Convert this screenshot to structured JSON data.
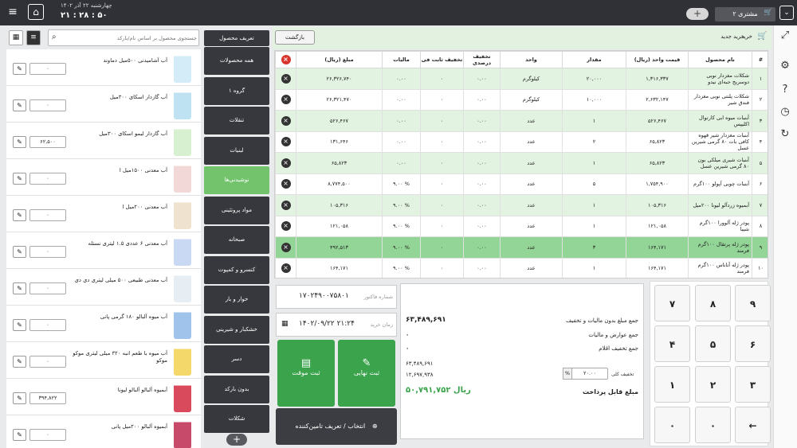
{
  "topbar": {
    "date": "چهارشنبه ۲۲ آذر ۱۴۰۲",
    "time": "۲۱ : ۲۸ : ۵۰",
    "customer": "مشتری ۲",
    "plus": "+"
  },
  "header": {
    "back": "بازگشت",
    "new_buy": "خرید جدید",
    "buy": "خرید"
  },
  "table": {
    "columns": [
      "#",
      "نام محصول",
      "قیمت واحد (ریال)",
      "مقدار",
      "واحد",
      "تخفیف درصدی",
      "تخفیف ثابت فی",
      "مالیات",
      "مبلغ (ریال)"
    ],
    "rows": [
      {
        "n": "۱",
        "name": "شکلات مغزدار نوبی دوسریج حبه‌ای نیدو",
        "price": "۱,۳۱۶,۳۳۷",
        "qty": "۲۰,۰۰۰",
        "unit": "کیلوگرم",
        "pct": "۰.۰۰",
        "fixed": "۰",
        "tax": "۰.۰۰",
        "amount": "۲۶,۳۲۶,۷۴۰"
      },
      {
        "n": "۲",
        "name": "شکلات پلنتی نوبی مغزدار فندق شیر",
        "price": "۲,۶۳۲,۱۴۷",
        "qty": "۱۰,۰۰۰",
        "unit": "کیلوگرم",
        "pct": "۰.۰۰",
        "fixed": "۰",
        "tax": "۰.۰۰",
        "amount": "۲۶,۳۲۱,۴۷۰"
      },
      {
        "n": "۳",
        "name": "آبنبات میوه ابی کارتوال اکلیپس",
        "price": "۵۲۶,۴۶۷",
        "qty": "۱",
        "unit": "عدد",
        "pct": "۰.۰۰",
        "fixed": "۰",
        "tax": "۰.۰۰",
        "amount": "۵۲۶,۴۶۷"
      },
      {
        "n": "۴",
        "name": "آبنبات مغزدار شیر قهوه کافی بات ۸۰ گرمی شیرین عسل",
        "price": "۶۵,۸۲۳",
        "qty": "۲",
        "unit": "عدد",
        "pct": "۰.۰۰",
        "fixed": "۰",
        "tax": "۰.۰۰",
        "amount": "۱۳۱,۶۴۶"
      },
      {
        "n": "۵",
        "name": "آبنبات شیری میلکی بون ۸۰ گرمی شیرین عسل",
        "price": "۶۵,۸۲۳",
        "qty": "۱",
        "unit": "عدد",
        "pct": "۰.۰۰",
        "fixed": "۰",
        "tax": "۰.۰۰",
        "amount": "۶۵,۸۲۳"
      },
      {
        "n": "۶",
        "name": "آبنبات چوبی آپولو ۱۰۰گرم",
        "price": "۱,۷۵۴,۹۰۰",
        "qty": "۵",
        "unit": "عدد",
        "pct": "۰.۰۰",
        "fixed": "۰",
        "tax": "% ۹.۰۰",
        "amount": "۸,۷۷۴,۵۰۰"
      },
      {
        "n": "۷",
        "name": "آبمیوه زردآلو لیونا ۲۰۰میل",
        "price": "۱۰۵,۳۱۶",
        "qty": "۱",
        "unit": "عدد",
        "pct": "۰.۰۰",
        "fixed": "۰",
        "tax": "% ۹.۰۰",
        "amount": "۱۰۵,۳۱۶"
      },
      {
        "n": "۸",
        "name": "پودر ژله آلوورا ۱۰۰گرم شیبا",
        "price": "۱۲۱,۰۵۸",
        "qty": "۱",
        "unit": "عدد",
        "pct": "۰.۰۰",
        "fixed": "۰",
        "tax": "% ۹.۰۰",
        "amount": "۱۲۱,۰۵۸"
      },
      {
        "n": "۹",
        "name": "پودر ژله پرتقال ۱۰۰گرم فرمند",
        "price": "۱۶۴,۱۷۱",
        "qty": "۳",
        "unit": "عدد",
        "pct": "۰.۰۰",
        "fixed": "۰",
        "tax": "% ۹.۰۰",
        "amount": "۴۹۲,۵۱۳"
      },
      {
        "n": "۱۰",
        "name": "پودر ژله آناناس ۱۰۰گرم فرمند",
        "price": "۱۶۴,۱۷۱",
        "qty": "۱",
        "unit": "عدد",
        "pct": "۰.۰۰",
        "fixed": "۰",
        "tax": "% ۹.۰۰",
        "amount": "۱۶۴,۱۷۱"
      }
    ]
  },
  "numpad": [
    "۹",
    "۸",
    "۷",
    "۶",
    "۵",
    "۴",
    "۳",
    "۲",
    "۱",
    "←",
    "۰",
    "۰"
  ],
  "summary": {
    "total_label": "جمع مبلغ بدون مالیات و تخفیف",
    "total": "۶۳,۴۸۹,۶۹۱",
    "tax_label": "جمع عوارض و مالیات",
    "tax": "۰",
    "disc_label": "جمع تخفیف اقلام",
    "disc": "۰",
    "sub1": "۶۳,۴۸۹,۶۹۱",
    "sub2": "۱۲,۶۹۷,۹۳۸",
    "overall_disc_label": "تخفیف کلی",
    "overall_disc": "۲۰.۰۰",
    "pct_sign": "%",
    "pay_label": "مبلغ قابل پرداخت",
    "pay": "۵۰,۷۹۱,۷۵۲ ریال"
  },
  "invoice": {
    "no_label": "شماره فاکتور",
    "no": "۱۷۰۲۴۹۰۰۷۵۸۰۱",
    "time_label": "زمان خرید",
    "time": "۱۴۰۲/۰۹/۲۲ ۲۱:۲۴"
  },
  "actions": {
    "final": "ثبت نهایی",
    "temp": "ثبت موقت",
    "supplier": "انتخاب / تعریف تامین‌کننده"
  },
  "categories": {
    "define": "تعریف محصول",
    "items": [
      "همه محصولات",
      "گروه ۱",
      "تنقلات",
      "لبنیات",
      "نوشیدنی‌ها",
      "مواد پروتئینی",
      "صبحانه",
      "کنسرو و کمپوت",
      "خوار و بار",
      "خشکبار و شیرینی",
      "دسر",
      "بدون بارکد",
      "شکلات"
    ],
    "active": 4
  },
  "search": {
    "placeholder": "جستجوی محصول بر اساس نام/بارکد"
  },
  "products": [
    {
      "name": "آب آشامیدنی ۵۰۰میل دماوند",
      "price": "۰",
      "color": "#d3ecf7"
    },
    {
      "name": "آب گازدار اسکای ۳۰۰میل",
      "price": "۰",
      "color": "#bfe2f3"
    },
    {
      "name": "آب گازدار لیمو اسکای ۳۰۰میل",
      "price": "۶۲,۵۰۰",
      "color": "#d6f0d0"
    },
    {
      "name": "آب معدنی ۱۵۰۰میل ا",
      "price": "۰",
      "color": "#f3d8d8"
    },
    {
      "name": "آب معدنی ۲۰۰میل ا",
      "price": "۰",
      "color": "#efe2cf"
    },
    {
      "name": "آب معدنی ۶ عددی ۱.۵ لیتری نستله",
      "price": "۰",
      "color": "#c9d9f3"
    },
    {
      "name": "آب معدنی طبیعی ۵۰۰ میلی لیتری دی دی",
      "price": "۰",
      "color": "#e6eef3"
    },
    {
      "name": "آب میوه آلبالو ۱۸۰ گرمی پانی",
      "price": "۰",
      "color": "#9fc3ea"
    },
    {
      "name": "آب میوه با طعم انبه ۳۲۰ میلی لیتری موکو موکو",
      "price": "۰",
      "color": "#f5d86a"
    },
    {
      "name": "آبمیوه آلبالو آلبالو لیونا",
      "price": "۳۹۴,۸۲۲",
      "color": "#d94a5c"
    },
    {
      "name": "آبمیوه آلبالو ۲۰۰میل پانی",
      "price": "۰",
      "color": "#c74a6b"
    }
  ]
}
